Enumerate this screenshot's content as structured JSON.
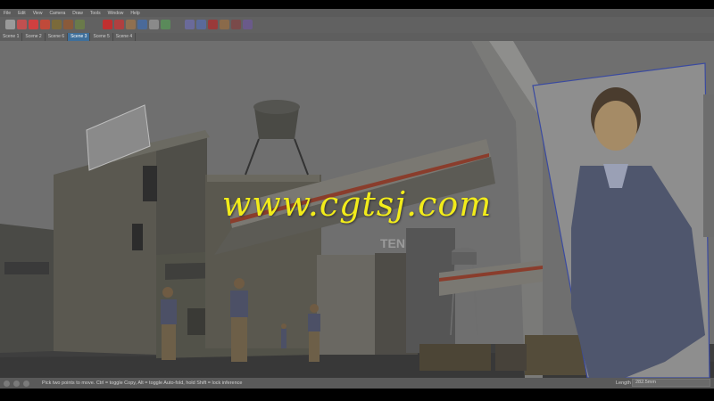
{
  "menu": [
    "File",
    "Edit",
    "View",
    "Camera",
    "Draw",
    "Tools",
    "Window",
    "Help"
  ],
  "toolbar_icons": [
    "select-icon",
    "eraser-icon",
    "pencil-icon",
    "arc-icon",
    "paint-bucket-icon",
    "push-pull-icon",
    "rectangle-icon",
    "move-icon",
    "rotate-icon",
    "offset-icon",
    "tape-measure-icon",
    "text-icon",
    "orbit-icon",
    "pan-icon",
    "zoom-icon",
    "zoom-extents-icon",
    "warehouse-icon",
    "component-icon",
    "extension-icon"
  ],
  "scenes": [
    {
      "label": "Scene 1",
      "active": false
    },
    {
      "label": "Scene 2",
      "active": false
    },
    {
      "label": "Scene 6",
      "active": false
    },
    {
      "label": "Scene 3",
      "active": true
    },
    {
      "label": "Scene 5",
      "active": false
    },
    {
      "label": "Scene 4",
      "active": false
    }
  ],
  "status": {
    "hint": "Pick two points to move.  Ctrl = toggle Copy, Alt = toggle Auto-fold, hold Shift = lock inference",
    "measure_label": "Length",
    "measure_value": "282.5mm"
  },
  "sign_text": "TEN",
  "watermark": "www.cgtsj.com"
}
